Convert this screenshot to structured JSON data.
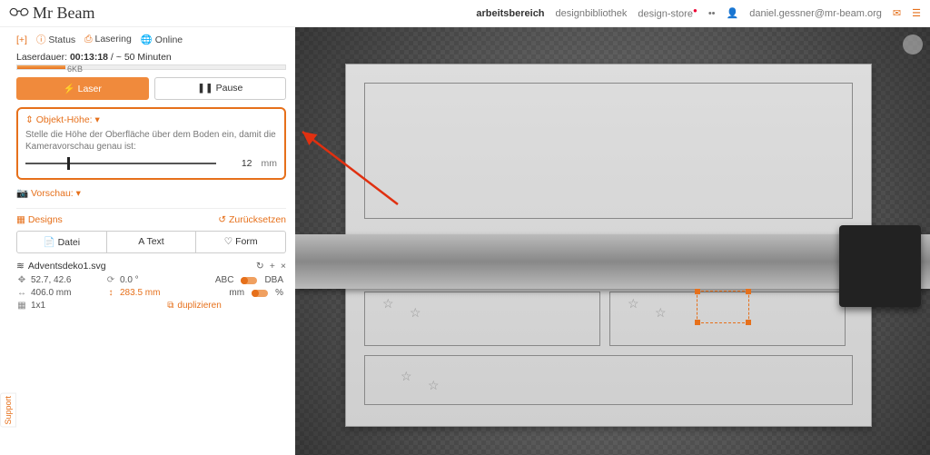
{
  "top": {
    "logo": "Mr Beam",
    "nav": [
      "arbeitsbereich",
      "designbibliothek",
      "design-store",
      "••",
      "daniel.gessner@mr-beam.org"
    ],
    "nav_active_index": 0
  },
  "status": {
    "expand": "[+]",
    "status_label": "Status",
    "lasering": "Lasering",
    "online": "Online"
  },
  "duration": {
    "label": "Laserdauer:",
    "elapsed": "00:13:18",
    "sep": "/",
    "est": "~ 50 Minuten",
    "size": "6KB"
  },
  "buttons": {
    "laser": "Laser",
    "pause": "Pause"
  },
  "height_panel": {
    "title": "Objekt-Höhe:",
    "caret": "▾",
    "desc": "Stelle die Höhe der Oberfläche über dem Boden ein, damit die Kameravorschau genau ist:",
    "value": "12",
    "unit": "mm"
  },
  "preview": {
    "label": "Vorschau:",
    "caret": "▾"
  },
  "designs": {
    "label": "Designs",
    "reset": "Zurücksetzen"
  },
  "triple": {
    "file": "Datei",
    "text": "Text",
    "form": "Form"
  },
  "file": {
    "name": "Adventsdeko1.svg",
    "refresh": "↻",
    "plus": "+",
    "close": "×",
    "pos": "52.7, 42.6",
    "rot": "0.0 °",
    "abc": "ABC",
    "dba": "DBA",
    "width": "406.0 mm",
    "height": "283.5 mm",
    "mm": "mm",
    "pct": "%",
    "grid": "1x1",
    "dup": "duplizieren"
  },
  "support": "Support"
}
